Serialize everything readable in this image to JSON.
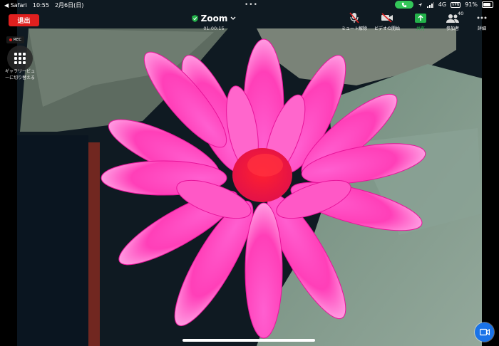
{
  "status_bar": {
    "back_app": "◀ Safari",
    "time": "10:55",
    "date": "2月6日(日)",
    "network": "4G",
    "vpn": "VPN",
    "battery": "91%"
  },
  "header": {
    "leave_label": "退出",
    "title": "Zoom",
    "timer": "01:00:15",
    "more_dots": "•••"
  },
  "toolbar": {
    "mute_label": "ミュート解除",
    "video_label": "ビデオの開始",
    "share_label": "共有",
    "participants_label": "参加者",
    "participants_count": "40",
    "details_label": "詳細"
  },
  "overlay": {
    "rec_label": "REC",
    "gallery_label": "ギャラリービューに切り替える"
  },
  "colors": {
    "leave_red": "#e0201f",
    "share_green": "#23b24a",
    "call_green": "#34c759",
    "chat_blue": "#1a73e8"
  }
}
